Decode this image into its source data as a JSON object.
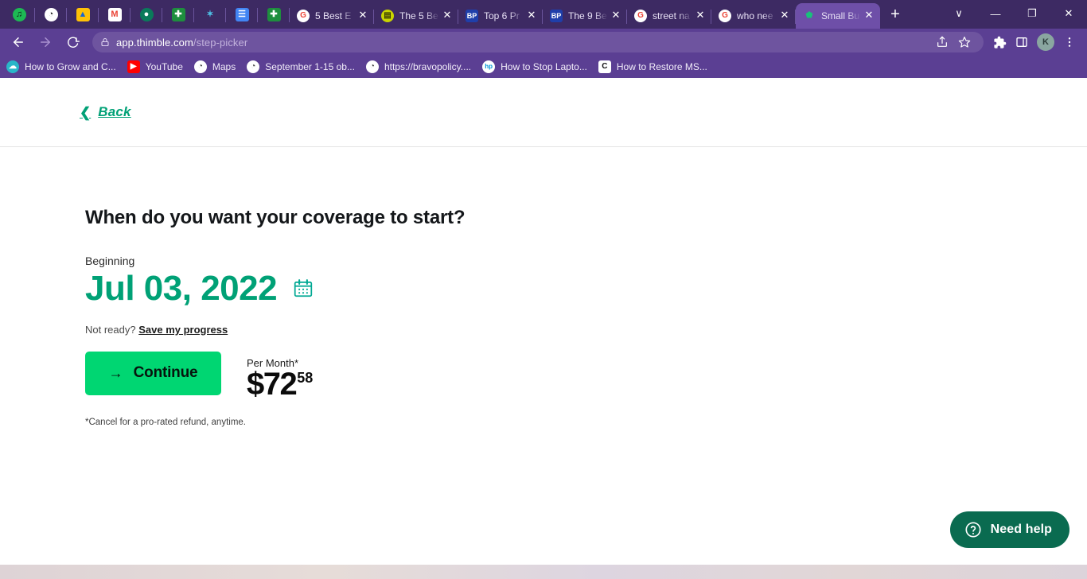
{
  "browser": {
    "pinned_tabs": [
      {
        "name": "spotify",
        "glyph": "♫",
        "bg": "#1db954",
        "fg": "#0b2016",
        "round": true
      },
      {
        "name": "globe",
        "glyph": "◔",
        "bg": "#ffffff",
        "fg": "#2b2b2b",
        "round": true
      },
      {
        "name": "google-drive",
        "glyph": "▲",
        "bg": "#ffc107",
        "fg": "#1967d2",
        "round": false
      },
      {
        "name": "gmail",
        "glyph": "M",
        "bg": "#ffffff",
        "fg": "#ea4335",
        "round": false
      },
      {
        "name": "circle-green",
        "glyph": "●",
        "bg": "#0a7a5a",
        "fg": "#ffffff",
        "round": true
      },
      {
        "name": "sheets",
        "glyph": "✚",
        "bg": "#1e8e3e",
        "fg": "#ffffff",
        "round": false
      },
      {
        "name": "bug",
        "glyph": "✶",
        "bg": "#3d2a63",
        "fg": "#4fc3e8",
        "round": false
      },
      {
        "name": "docs",
        "glyph": "☰",
        "bg": "#4285f4",
        "fg": "#ffffff",
        "round": false
      },
      {
        "name": "sheets-2",
        "glyph": "✚",
        "bg": "#1e8e3e",
        "fg": "#ffffff",
        "round": false
      }
    ],
    "tabs": [
      {
        "title": "5 Best E",
        "favicon": "google",
        "fav_glyph": "G",
        "fav_bg": "#ffffff",
        "fav_fg": "#ea4335",
        "active": false
      },
      {
        "title": "The 5 Be",
        "favicon": "site-yellow",
        "fav_glyph": "▤",
        "fav_bg": "#c8d400",
        "fav_fg": "#3a3a00",
        "active": false
      },
      {
        "title": "Top 6 Pr",
        "favicon": "bp",
        "fav_glyph": "BP",
        "fav_bg": "#1f3faa",
        "fav_fg": "#ffffff",
        "active": false
      },
      {
        "title": "The 9 Be",
        "favicon": "bp",
        "fav_glyph": "BP",
        "fav_bg": "#1f3faa",
        "fav_fg": "#ffffff",
        "active": false
      },
      {
        "title": "street na",
        "favicon": "google",
        "fav_glyph": "G",
        "fav_bg": "#ffffff",
        "fav_fg": "#ea4335",
        "active": false
      },
      {
        "title": "who nee",
        "favicon": "google",
        "fav_glyph": "G",
        "fav_bg": "#ffffff",
        "fav_fg": "#ea4335",
        "active": false
      },
      {
        "title": "Small Bu",
        "favicon": "thimble",
        "fav_glyph": "⬟",
        "fav_bg": "#6e4fa8",
        "fav_fg": "#17c27a",
        "active": true
      }
    ],
    "new_tab_glyph": "+",
    "window_controls": {
      "tab_search": "∨",
      "minimize": "—",
      "maximize": "❐",
      "close": "✕"
    },
    "url_domain": "app.thimble.com",
    "url_path": "/step-picker",
    "bookmarks": [
      {
        "label": "How to Grow and C...",
        "glyph": "☁",
        "bg": "#29b6c8",
        "fg": "#ffffff"
      },
      {
        "label": "YouTube",
        "glyph": "▶",
        "bg": "#ff0000",
        "fg": "#ffffff"
      },
      {
        "label": "Maps",
        "glyph": "◔",
        "bg": "#ffffff",
        "fg": "#3a3a3a"
      },
      {
        "label": "September 1-15 ob...",
        "glyph": "◔",
        "bg": "#ffffff",
        "fg": "#3a3a3a"
      },
      {
        "label": "https://bravopolicy....",
        "glyph": "◔",
        "bg": "#ffffff",
        "fg": "#3a3a3a"
      },
      {
        "label": "How to Stop Lapto...",
        "glyph": "hp",
        "bg": "#ffffff",
        "fg": "#0096d6"
      },
      {
        "label": "How to Restore MS...",
        "glyph": "C",
        "bg": "#ffffff",
        "fg": "#111111"
      }
    ]
  },
  "page": {
    "back_label": "Back",
    "title": "When do you want your coverage to start?",
    "beginning_label": "Beginning",
    "date_value": "Jul 03, 2022",
    "not_ready_text": "Not ready?",
    "save_progress_label": "Save my progress",
    "continue_label": "Continue",
    "continue_arrow": "→",
    "per_month_label": "Per Month*",
    "price_dollars": "$72",
    "price_cents": "58",
    "fineprint": "*Cancel for a pro-rated refund, anytime.",
    "need_help_label": "Need help",
    "accent_green": "#00a176",
    "cta_green": "#00d672",
    "help_green": "#0a6b50"
  }
}
